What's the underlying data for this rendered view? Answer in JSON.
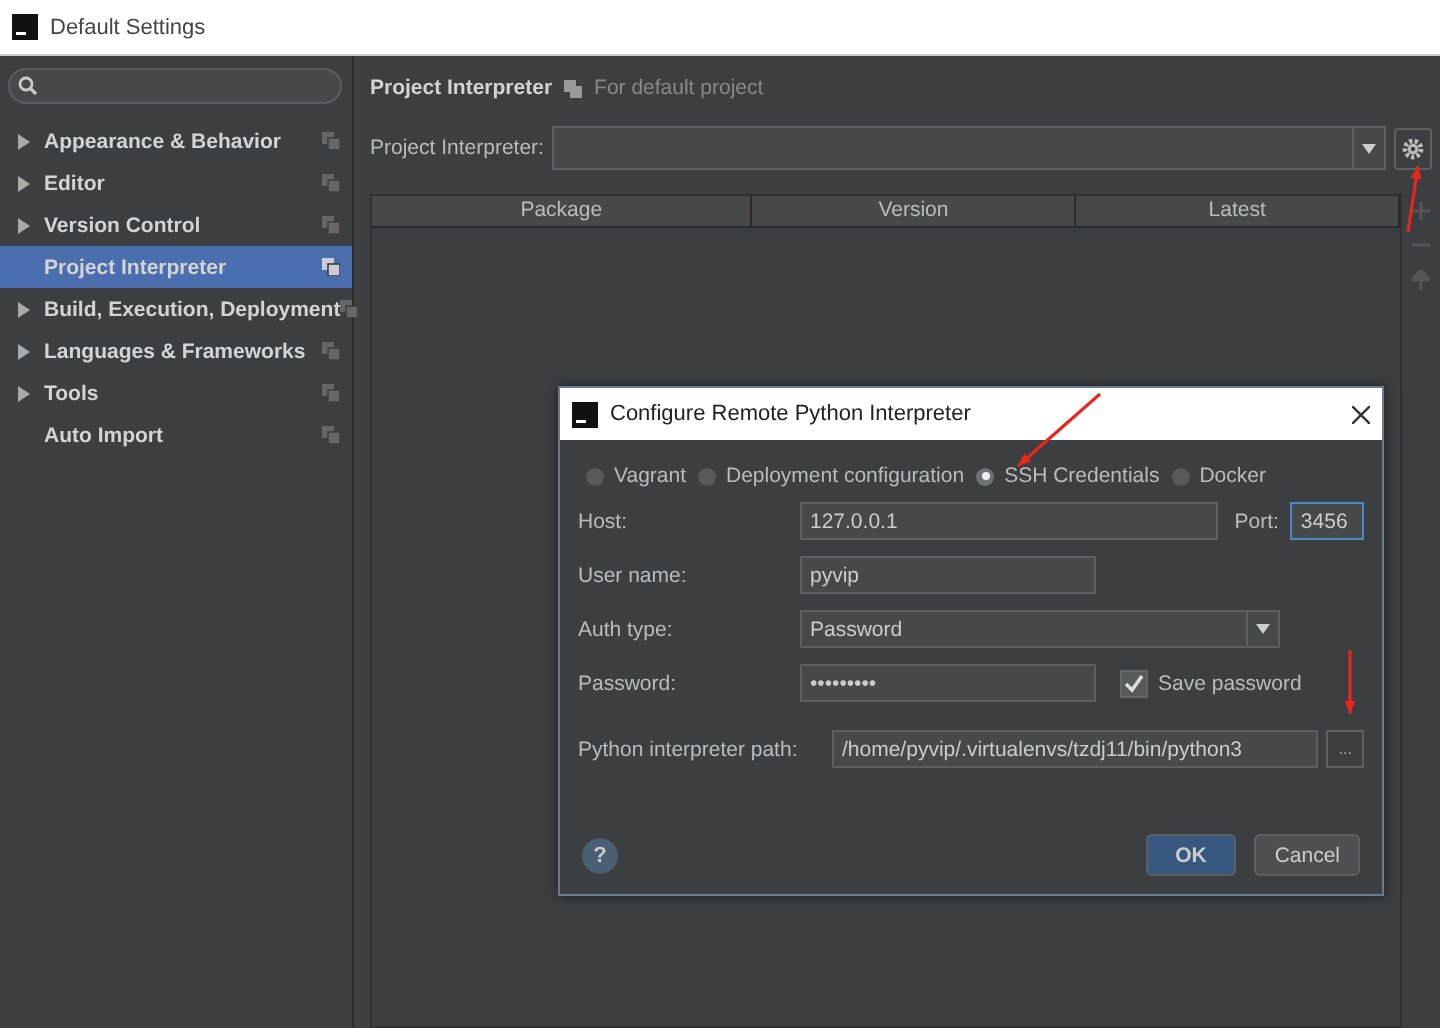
{
  "window": {
    "title": "Default Settings"
  },
  "sidebar": {
    "items": [
      {
        "label": "Appearance & Behavior",
        "kind": "group",
        "expanded": false,
        "selected": false
      },
      {
        "label": "Editor",
        "kind": "group",
        "expanded": false,
        "selected": false
      },
      {
        "label": "Version Control",
        "kind": "group",
        "expanded": false,
        "selected": false
      },
      {
        "label": "Project Interpreter",
        "kind": "page",
        "selected": true
      },
      {
        "label": "Build, Execution, Deployment",
        "kind": "group",
        "expanded": false,
        "selected": false
      },
      {
        "label": "Languages & Frameworks",
        "kind": "group",
        "expanded": false,
        "selected": false
      },
      {
        "label": "Tools",
        "kind": "group",
        "expanded": false,
        "selected": false
      },
      {
        "label": "Auto Import",
        "kind": "page",
        "selected": false
      }
    ]
  },
  "main": {
    "title": "Project Interpreter",
    "scope": "For default project",
    "interpreter_label": "Project Interpreter:",
    "table": {
      "columns": [
        "Package",
        "Version",
        "Latest"
      ]
    }
  },
  "dialog": {
    "title": "Configure Remote Python Interpreter",
    "options": [
      {
        "label": "Vagrant",
        "selected": false
      },
      {
        "label": "Deployment configuration",
        "selected": false
      },
      {
        "label": "SSH Credentials",
        "selected": true
      },
      {
        "label": "Docker",
        "selected": false
      }
    ],
    "host_label": "Host:",
    "host": "127.0.0.1",
    "port_label": "Port:",
    "port": "3456",
    "user_label": "User name:",
    "user": "pyvip",
    "auth_label": "Auth type:",
    "auth": "Password",
    "password_label": "Password:",
    "password": "•••••••••",
    "save_password": {
      "label": "Save password",
      "checked": true
    },
    "path_label": "Python interpreter path:",
    "path": "/home/pyvip/.virtualenvs/tzdj11/bin/python3",
    "browse": "...",
    "help": "?",
    "buttons": [
      {
        "label": "OK",
        "kind": "primary"
      },
      {
        "label": "Cancel",
        "kind": "secondary"
      }
    ]
  }
}
